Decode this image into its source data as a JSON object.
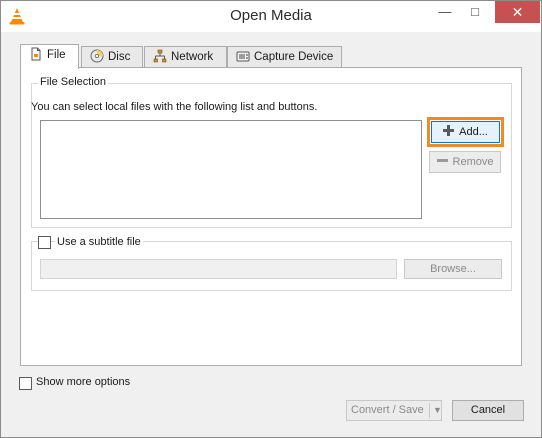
{
  "window": {
    "title": "Open Media"
  },
  "titlebar": {
    "minimize": "—",
    "maximize": "□",
    "close": "✕"
  },
  "tabs": [
    {
      "label": "File",
      "icon": "file-icon",
      "active": true
    },
    {
      "label": "Disc",
      "icon": "disc-icon",
      "active": false
    },
    {
      "label": "Network",
      "icon": "network-icon",
      "active": false
    },
    {
      "label": "Capture Device",
      "icon": "capture-device-icon",
      "active": false
    }
  ],
  "file_selection": {
    "title": "File Selection",
    "hint": "You can select local files with the following list and buttons.",
    "files": [],
    "add_label": "Add...",
    "remove_label": "Remove"
  },
  "subtitle": {
    "label": "Use a subtitle file",
    "checked": false,
    "value": "",
    "browse_label": "Browse..."
  },
  "options": {
    "show_more_label": "Show more options",
    "checked": false
  },
  "footer": {
    "convert_label": "Convert / Save",
    "cancel_label": "Cancel"
  },
  "colors": {
    "highlight": "#f08a24",
    "close": "#c75050",
    "vlc_orange": "#ff8800"
  }
}
